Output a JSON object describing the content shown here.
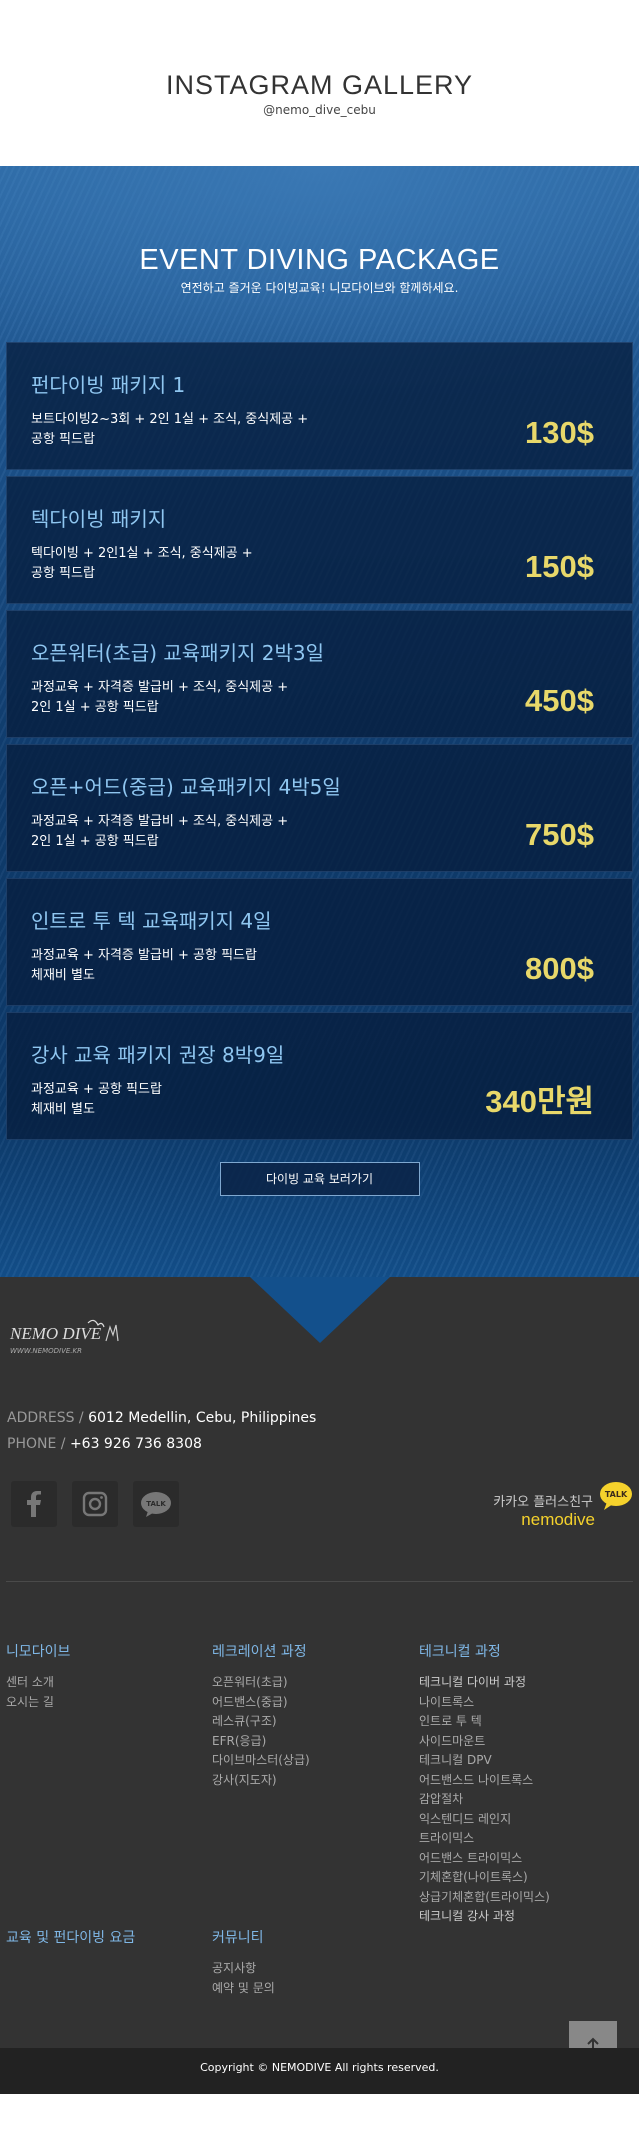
{
  "instagram": {
    "title": "INSTAGRAM GALLERY",
    "handle": "@nemo_dive_cebu"
  },
  "event": {
    "title": "EVENT DIVING PACKAGE",
    "subtitle": "연전하고 즐거운 다이빙교육! 니모다이브와 함께하세요.",
    "packages": [
      {
        "title": "펀다이빙 패키지 1",
        "desc1": "보트다이빙2~3회 + 2인 1실 + 조식, 중식제공 +",
        "desc2": "공항 픽드랍",
        "price": "130$"
      },
      {
        "title": "텍다이빙 패키지",
        "desc1": "텍다이빙 + 2인1실 + 조식, 중식제공 +",
        "desc2": "공항 픽드랍",
        "price": "150$"
      },
      {
        "title": "오픈워터(초급) 교육패키지 2박3일",
        "desc1": "과정교육 + 자격증 발급비 + 조식, 중식제공 +",
        "desc2": "2인 1실 + 공항 픽드랍",
        "price": "450$"
      },
      {
        "title": "오픈+어드(중급) 교육패키지 4박5일",
        "desc1": "과정교육 + 자격증 발급비 + 조식, 중식제공 +",
        "desc2": "2인 1실 + 공항 픽드랍",
        "price": "750$"
      },
      {
        "title": "인트로 투 텍 교육패키지 4일",
        "desc1": "과정교육 + 자격증 발급비 + 공항 픽드랍",
        "desc2": "체재비 별도",
        "price": "800$"
      },
      {
        "title": "강사 교육 패키지 권장 8박9일",
        "desc1": "과정교육 + 공항 픽드랍",
        "desc2": "체재비 별도",
        "price": "340만원"
      }
    ],
    "button": "다이빙 교육 보러가기"
  },
  "footer": {
    "logo": {
      "name": "NEMO DIVE",
      "url": "WWW.NEMODIVE.KR"
    },
    "address_label": "ADDRESS /",
    "address": "6012 Medellin, Cebu, Philippines",
    "phone_label": "PHONE /",
    "phone": "+63 926 736 8308",
    "social": [
      "facebook-icon",
      "instagram-icon",
      "kakaotalk-icon"
    ],
    "kakao": {
      "line1": "카카오 플러스친구",
      "line2": "nemodive",
      "badge": "TALK"
    },
    "menus": [
      {
        "title": "니모다이브",
        "items": [
          "센터 소개",
          "오시는 길"
        ]
      },
      {
        "title": "레크레이션 과정",
        "items": [
          "오픈워터(초급)",
          "어드밴스(중급)",
          "레스큐(구조)",
          "EFR(응급)",
          "다이브마스터(상급)",
          "강사(지도자)"
        ]
      },
      {
        "title": "테크니컬 과정",
        "items": [
          "테크니컬 다이버 과정",
          "나이트록스",
          "인트로 투 텍",
          "사이드마운트",
          "테크니컬 DPV",
          "어드밴스드 나이트록스",
          "감압절차",
          "익스텐디드 레인지",
          "트라이믹스",
          "어드밴스 트라이믹스",
          "기체혼합(나이트록스)",
          "상급기체혼합(트라이믹스)",
          "테크니컬 강사 과정"
        ]
      },
      {
        "title": "교육 및 펀다이빙 요금",
        "items": []
      },
      {
        "title": "커뮤니티",
        "items": [
          "공지사항",
          "예약 및 문의"
        ]
      }
    ],
    "to_top": "arrow-up-icon",
    "copyright": "Copyright © NEMODIVE All rights reserved."
  }
}
